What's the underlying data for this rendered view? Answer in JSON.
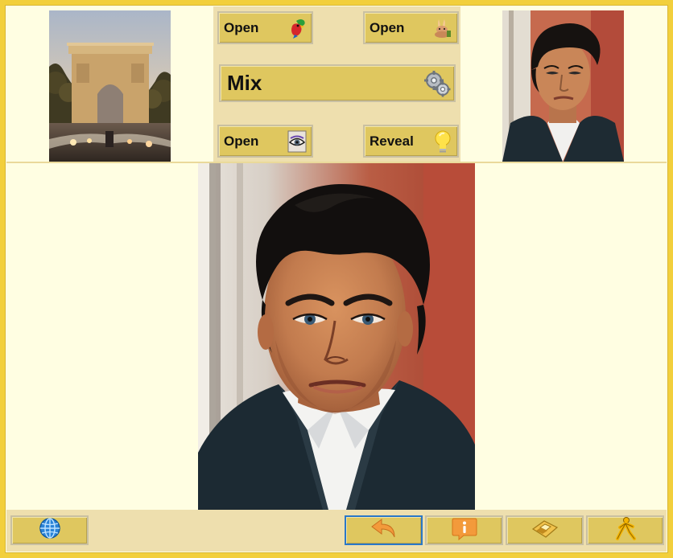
{
  "panel": {
    "open_top_left_label": "Open",
    "open_top_right_label": "Open",
    "mix_label": "Mix",
    "open_bottom_left_label": "Open",
    "reveal_label": "Reveal"
  },
  "icons": {
    "open_top_left": "parrot-icon",
    "open_top_right": "rabbit-icon",
    "mix": "gears-icon",
    "open_bottom_left": "eye-icon",
    "reveal": "lightbulb-icon",
    "globe": "globe-icon",
    "back": "back-arrow-icon",
    "info": "info-icon",
    "disk": "floppy-disk-icon",
    "user": "running-person-icon"
  },
  "images": {
    "left_thumb": "arc-de-triomphe-photo",
    "right_thumb": "portrait-thumbnail",
    "main": "portrait-photo"
  },
  "colors": {
    "frame": "#f2cf3c",
    "background": "#fffee2",
    "panel": "#eedfae",
    "button": "#dfc75f",
    "selected_outline": "#2b78c8"
  }
}
